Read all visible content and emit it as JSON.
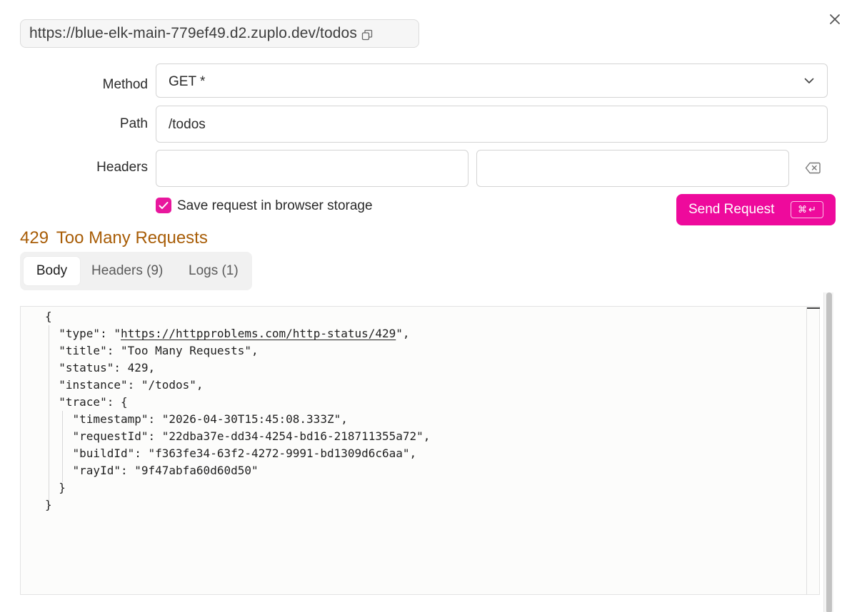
{
  "url": "https://blue-elk-main-779ef49.d2.zuplo.dev/todos",
  "form": {
    "method_label": "Method",
    "method_value": "GET *",
    "path_label": "Path",
    "path_value": "/todos",
    "headers_label": "Headers",
    "header_key": "",
    "header_value": "",
    "save_label": "Save request in browser storage",
    "save_checked": true
  },
  "send_button": {
    "label": "Send Request",
    "shortcut_cmd": "⌘",
    "shortcut_enter": "↵"
  },
  "response": {
    "status_code": "429",
    "status_text": "Too Many Requests",
    "tabs": [
      {
        "label": "Body",
        "active": true
      },
      {
        "label": "Headers (9)",
        "active": false
      },
      {
        "label": "Logs (1)",
        "active": false
      }
    ],
    "body_lines": [
      "{",
      "  \"type\": \"",
      "https://httpproblems.com/http-status/429",
      "\",",
      "  \"title\": \"Too Many Requests\",",
      "  \"status\": 429,",
      "  \"instance\": \"/todos\",",
      "  \"trace\": {",
      "    \"timestamp\": \"2026-04-30T15:45:08.333Z\",",
      "    \"requestId\": \"22dba37e-dd34-4254-bd16-218711355a72\",",
      "    \"buildId\": \"f363fe34-63f2-4272-9991-bd1309d6c6aa\",",
      "    \"rayId\": \"9f47abfa60d60d50\"",
      "  }",
      "}"
    ]
  },
  "colors": {
    "accent": "#ee0a9c",
    "status": "#a85d07"
  },
  "icons": {
    "close": "close-icon",
    "copy": "copy-icon",
    "chevron": "chevron-down-icon",
    "clear": "backspace-icon",
    "check": "check-icon"
  }
}
